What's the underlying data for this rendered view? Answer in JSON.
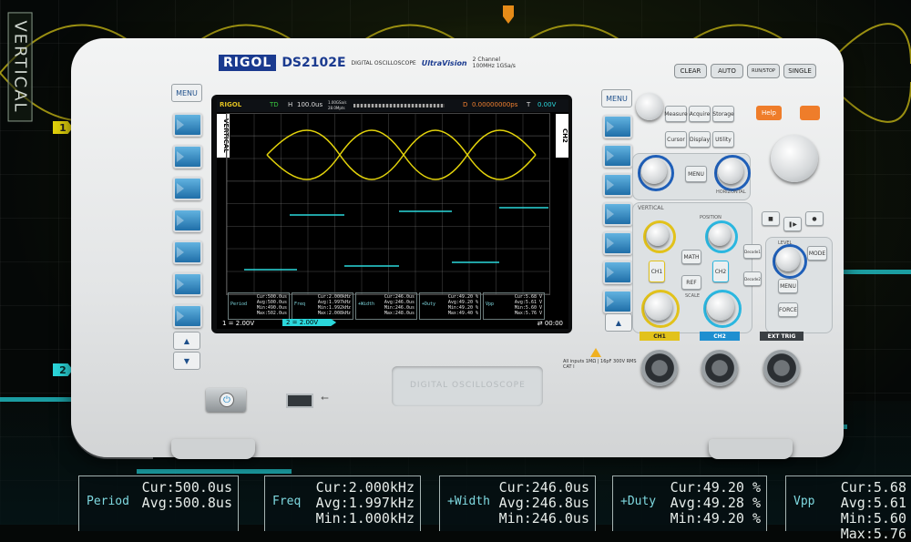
{
  "background": {
    "vertical_label": "VERTICAL",
    "ch1_marker": "1",
    "ch2_marker": "2",
    "big_measurements": [
      {
        "name": "Period",
        "values": "Cur:500.0us\nAvg:500.8us"
      },
      {
        "name": "Freq",
        "values": "Cur:2.000kHz\nAvg:1.997kHz\nMin:1.000kHz"
      },
      {
        "name": "+Width",
        "values": "Cur:246.0us\nAvg:246.8us\nMin:246.0us"
      },
      {
        "name": "+Duty",
        "values": "Cur:49.20 %\nAvg:49.28 %\nMin:49.20 %"
      },
      {
        "name": "Vpp",
        "values": "Cur:5.68\nAvg:5.61\nMin:5.60\nMax:5.76"
      }
    ]
  },
  "device": {
    "brand": "RIGOL",
    "model": "DS2102E",
    "subtitle": "DIGITAL OSCILLOSCOPE",
    "series": "UltraVision",
    "spec_line1": "2 Channel",
    "spec_line2": "100MHz 1GSa/s",
    "top_buttons": [
      "CLEAR",
      "AUTO",
      "RUN/STOP",
      "SINGLE"
    ],
    "left_menu_label": "MENU",
    "right_menu_label": "MENU",
    "function_buttons": [
      "Measure",
      "Acquire",
      "Storage",
      "Cursor",
      "Display",
      "Utility"
    ],
    "help_label": "Help",
    "horizontal_menu_label": "MENU",
    "horizontal_section": "HORIZONTAL",
    "vertical_section": "VERTICAL",
    "position_label": "POSITION",
    "math_label": "MATH",
    "ref_label": "REF",
    "ch1_button": "CH1",
    "ch2_button": "CH2",
    "scale_label": "SCALE",
    "decode1": "Decode1",
    "decode2": "Decode2",
    "mode_label": "MODE",
    "trig_menu": "MENU",
    "force_label": "FORCE",
    "level_label": "LEVEL",
    "ch1_input": "CH1",
    "ch2_input": "CH2",
    "ext_trig": "EXT TRIG",
    "warning_text": "All inputs 1MΩ | 16pF 300V RMS CAT I",
    "bottom_plate_text": "DIGITAL OSCILLOSCOPE"
  },
  "screen": {
    "logo": "RIGOL",
    "status": "TD",
    "timebase_label": "H",
    "timebase": "100.0us",
    "sample_rate_a": "1.00GSa/s",
    "sample_rate_b": "28.0Mpts",
    "delay_label": "D",
    "delay": "0.00000000ps",
    "trigger_label": "T",
    "trigger_value": "0.00V",
    "left_tab": "VERTICAL",
    "right_tab": "CH2",
    "ch1_scale": "1  =  2.00V",
    "ch2_scale": "2  =  2.00V",
    "usb_status": "⇄ 00:00",
    "measurements": [
      {
        "name": "Period",
        "values": "Cur:500.0us\nAvg:500.0us\nMin:490.0us\nMax:502.0us"
      },
      {
        "name": "Freq",
        "values": "Cur:2.000kHz\nAvg:1.997kHz\nMin:1.992kHz\nMax:2.008kHz"
      },
      {
        "name": "+Width",
        "values": "Cur:246.0us\nAvg:246.0us\nMin:246.0us\nMax:248.0us"
      },
      {
        "name": "+Duty",
        "values": "Cur:49.20 %\nAvg:49.20 %\nMin:49.20 %\nMax:49.40 %"
      },
      {
        "name": "Vpp",
        "values": "Cur:5.68 V\nAvg:5.61 V\nMin:5.60 V\nMax:5.76 V"
      }
    ]
  },
  "colors": {
    "ch1": "#e2d20b",
    "ch2": "#2bd7db",
    "brand_blue": "#1a3a8f",
    "accent_orange": "#ef7d2a"
  }
}
